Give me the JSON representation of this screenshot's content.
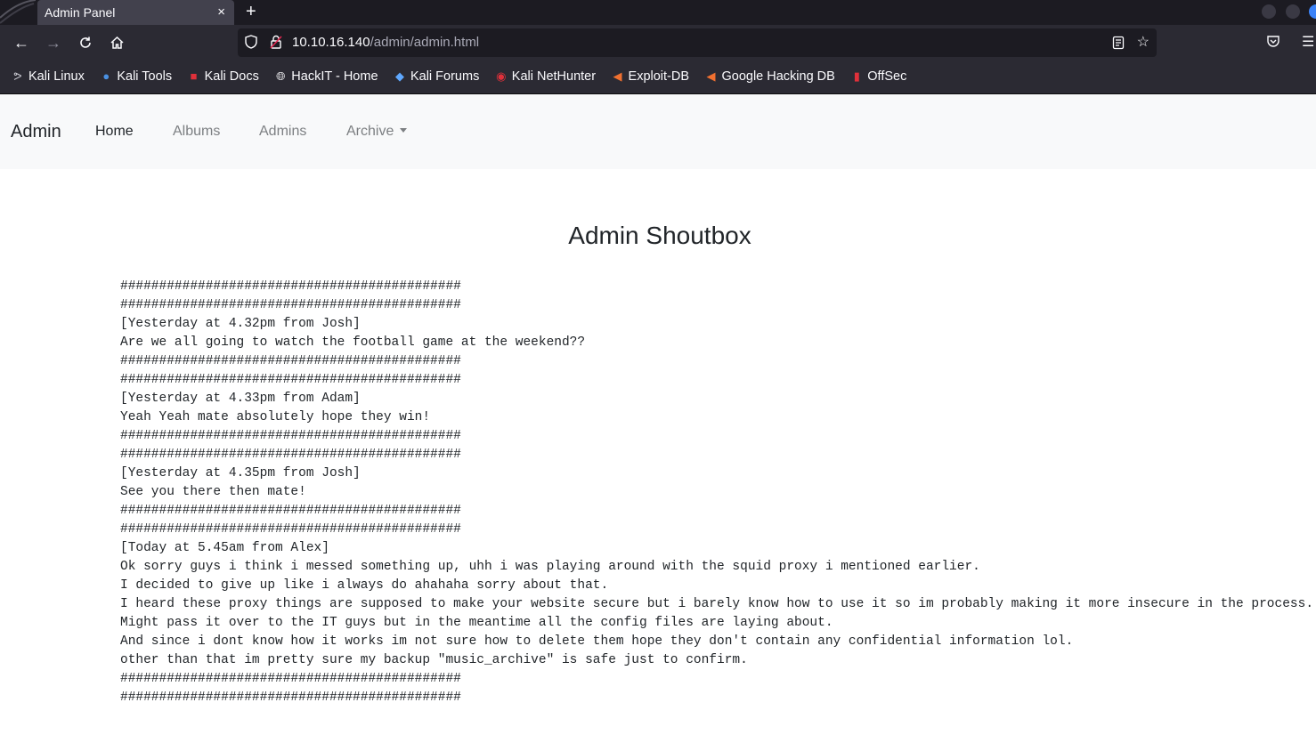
{
  "browser": {
    "tab_title": "Admin Panel",
    "tab_close": "×",
    "new_tab": "+",
    "url_host": "10.10.16.140",
    "url_path": "/admin/admin.html",
    "bookmarks": [
      {
        "label": "Kali Linux",
        "icon": "kali-dragon-icon"
      },
      {
        "label": "Kali Tools",
        "icon": "kali-tools-icon"
      },
      {
        "label": "Kali Docs",
        "icon": "kali-docs-icon"
      },
      {
        "label": "HackIT - Home",
        "icon": "globe-icon"
      },
      {
        "label": "Kali Forums",
        "icon": "kali-forums-icon"
      },
      {
        "label": "Kali NetHunter",
        "icon": "nethunter-icon"
      },
      {
        "label": "Exploit-DB",
        "icon": "exploit-db-icon"
      },
      {
        "label": "Google Hacking DB",
        "icon": "ghdb-icon"
      },
      {
        "label": "OffSec",
        "icon": "offsec-icon"
      }
    ]
  },
  "nav": {
    "brand": "Admin",
    "home": "Home",
    "albums": "Albums",
    "admins": "Admins",
    "archive": "Archive"
  },
  "main": {
    "title": "Admin Shoutbox",
    "lines": [
      "############################################",
      "############################################",
      "[Yesterday at 4.32pm from Josh]",
      "Are we all going to watch the football game at the weekend??",
      "############################################",
      "############################################",
      "[Yesterday at 4.33pm from Adam]",
      "Yeah Yeah mate absolutely hope they win!",
      "############################################",
      "############################################",
      "[Yesterday at 4.35pm from Josh]",
      "See you there then mate!",
      "############################################",
      "############################################",
      "[Today at 5.45am from Alex]",
      "Ok sorry guys i think i messed something up, uhh i was playing around with the squid proxy i mentioned earlier.",
      "I decided to give up like i always do ahahaha sorry about that.",
      "I heard these proxy things are supposed to make your website secure but i barely know how to use it so im probably making it more insecure in the process.",
      "Might pass it over to the IT guys but in the meantime all the config files are laying about.",
      "And since i dont know how it works im not sure how to delete them hope they don't contain any confidential information lol.",
      "other than that im pretty sure my backup \"music_archive\" is safe just to confirm.",
      "############################################",
      "############################################"
    ]
  }
}
